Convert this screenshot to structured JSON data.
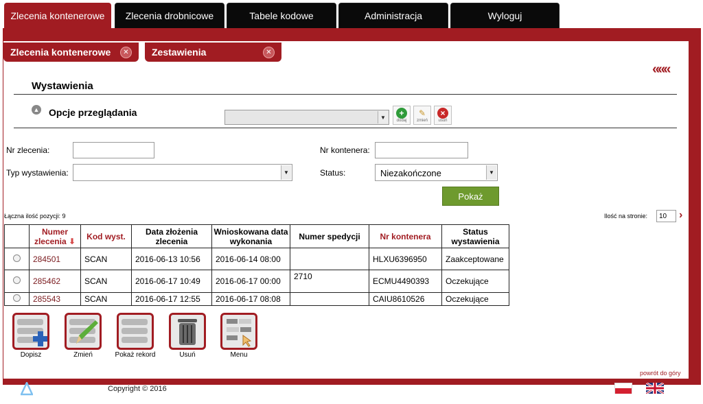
{
  "nav": {
    "tabs": [
      "Zlecenia kontenerowe",
      "Zlecenia drobnicowe",
      "Tabele kodowe",
      "Administracja",
      "Wyloguj"
    ]
  },
  "subtabs": [
    "Zlecenia kontenerowe",
    "Zestawienia"
  ],
  "collapse_glyph": "«««",
  "page": {
    "title": "Wystawienia",
    "options_label": "Opcje przeglądania",
    "toolbar": {
      "add": "dodaj",
      "edit": "zmień",
      "delete": "usuń"
    }
  },
  "filters": {
    "nr_zlecenia_label": "Nr zlecenia:",
    "nr_zlecenia_value": "",
    "typ_label": "Typ wystawienia:",
    "typ_value": "",
    "nr_kontenera_label": "Nr kontenera:",
    "nr_kontenera_value": "",
    "status_label": "Status:",
    "status_value": "Niezakończone",
    "show_button": "Pokaż"
  },
  "summary": {
    "total_label": "Łączna ilość pozycji: 9",
    "per_page_label": "Ilość na stronie:",
    "per_page_value": "10"
  },
  "table": {
    "headers": {
      "nr": "Numer zlecenia",
      "kod": "Kod wyst.",
      "data_zlozenia": "Data złożenia zlecenia",
      "wnioskowana": "Wnioskowana data wykonania",
      "spedycja": "Numer spedycji",
      "kontener": "Nr kontenera",
      "status": "Status wystawienia"
    },
    "rows": [
      {
        "nr": "284501",
        "kod": "SCAN",
        "data_zlozenia": "2016-06-13 10:56",
        "wnioskowana": "2016-06-14 08:00",
        "spedycja": "",
        "kontener": "HLXU6396950",
        "status": "Zaakceptowane"
      },
      {
        "nr": "285462",
        "kod": "SCAN",
        "data_zlozenia": "2016-06-17 10:49",
        "wnioskowana": "2016-06-17 00:00",
        "spedycja": "2710",
        "kontener": "ECMU4490393",
        "status": "Oczekujące"
      },
      {
        "nr": "285543",
        "kod": "SCAN",
        "data_zlozenia": "2016-06-17 12:55",
        "wnioskowana": "2016-06-17 08:08",
        "spedycja": "",
        "kontener": "CAIU8610526",
        "status": "Oczekujące"
      }
    ]
  },
  "actions": [
    "Dopisz",
    "Zmień",
    "Pokaż rekord",
    "Usuń",
    "Menu"
  ],
  "footer": {
    "back_to_top": "powrót do góry",
    "logo": "trisoft",
    "copyright": "Copyright © 2016"
  },
  "colors": {
    "brand": "#a11c22",
    "nav_bg": "#0a0a0a",
    "show_button": "#6e9a2e"
  }
}
